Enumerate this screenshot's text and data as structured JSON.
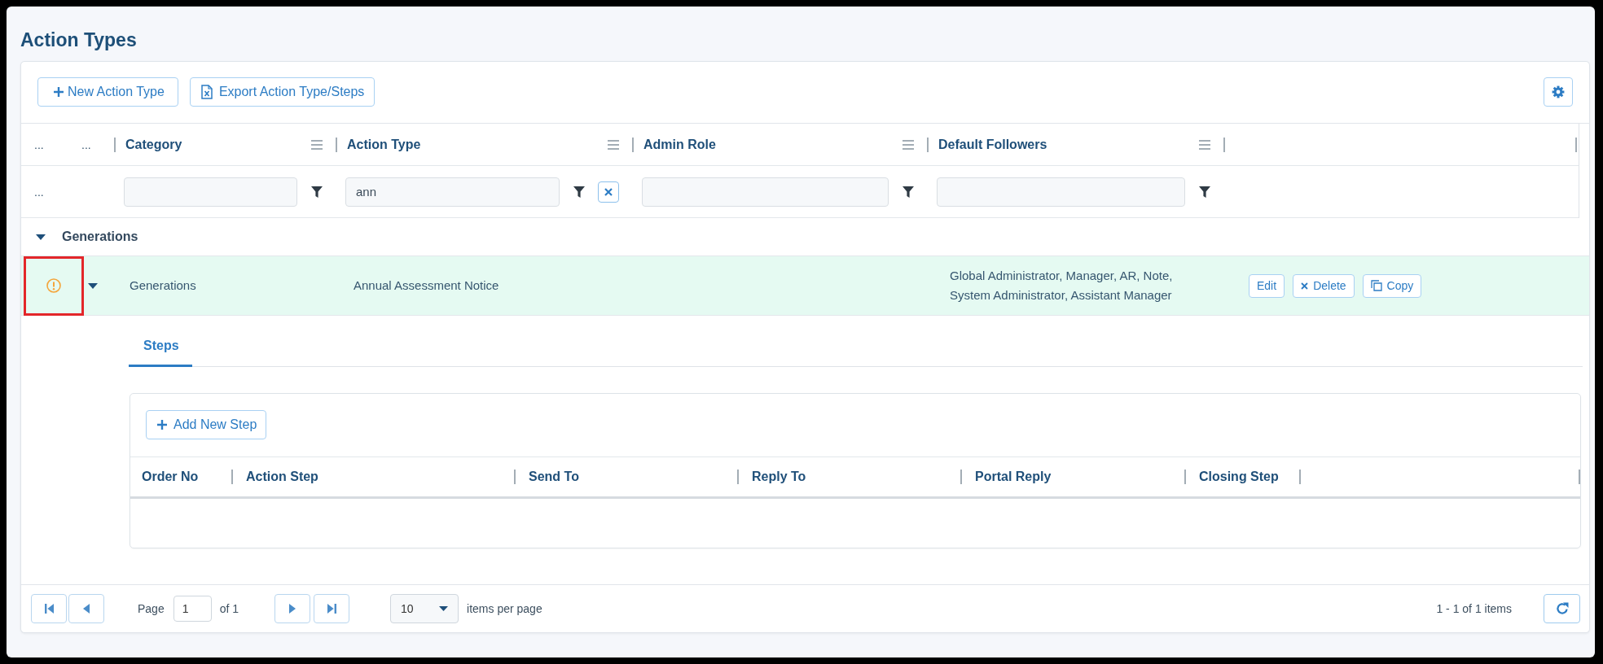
{
  "page": {
    "title": "Action Types"
  },
  "toolbar": {
    "buttons": [
      {
        "label": "New Action Type",
        "kind": "add"
      },
      {
        "label": "Export Action Type/Steps",
        "kind": "export"
      }
    ]
  },
  "grid": {
    "columns": [
      {
        "label": "...",
        "kind": "marker"
      },
      {
        "label": "...",
        "kind": "marker"
      },
      {
        "label": "Category",
        "kind": "data"
      },
      {
        "label": "Action Type",
        "kind": "data"
      },
      {
        "label": "Admin Role",
        "kind": "data"
      },
      {
        "label": "Default Followers",
        "kind": "data"
      }
    ],
    "filter_row": {
      "marker": "...",
      "fields": [
        {
          "clearable": false
        },
        {
          "value": "ann",
          "clearable": true
        },
        {
          "clearable": false
        },
        {
          "clearable": false
        }
      ]
    },
    "groups": [
      {
        "label": "Generations",
        "expanded": true,
        "rows": [
          {
            "selected": true,
            "expanded": true,
            "warning": true,
            "highlighted": true,
            "category": "Generations",
            "action_type": "Annual Assessment Notice",
            "default_followers": "Global Administrator, Manager, AR, Note, System Administrator, Assistant Manager",
            "actions": [
              {
                "label": "Edit",
                "kind": "edit"
              },
              {
                "label": "Delete",
                "kind": "delete"
              },
              {
                "label": "Copy",
                "kind": "copy"
              }
            ],
            "detail": {
              "tabs": [
                {
                  "label": "Steps",
                  "selected": true
                }
              ],
              "add_button": "Add New Step",
              "columns": [
                "Order No",
                "Action Step",
                "Send To",
                "Reply To",
                "Portal Reply",
                "Closing Step"
              ]
            }
          }
        ]
      }
    ]
  },
  "pager": {
    "page_label": "Page",
    "page": "1",
    "page_count": "of 1",
    "page_size": "10",
    "page_size_label": "items per page",
    "summary": "1 - 1 of 1 items"
  }
}
